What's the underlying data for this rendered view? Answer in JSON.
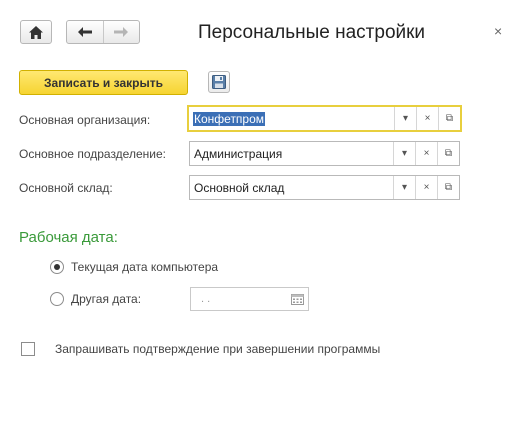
{
  "window": {
    "title": "Персональные настройки",
    "close_glyph": "×"
  },
  "nav": {
    "home_icon": "home-icon",
    "back_icon": "arrow-left-icon",
    "forward_icon": "arrow-right-icon"
  },
  "toolbar": {
    "save_close_label": "Записать и закрыть",
    "save_icon": "floppy-disk-icon"
  },
  "fields": [
    {
      "label": "Основная организация:",
      "value": "Конфетпром",
      "selected": true
    },
    {
      "label": "Основное подразделение:",
      "value": "Администрация",
      "selected": false
    },
    {
      "label": "Основной склад:",
      "value": "Основной склад",
      "selected": false
    }
  ],
  "field_buttons": {
    "dropdown": "▾",
    "clear": "×",
    "open": "⧉"
  },
  "work_date": {
    "section_title": "Рабочая дата:",
    "option_current": "Текущая дата компьютера",
    "option_other": "Другая дата:",
    "selected_option": "current",
    "date_placeholder": " .  . "
  },
  "confirm_exit": {
    "label": "Запрашивать подтверждение при завершении программы",
    "checked": false
  },
  "colors": {
    "accent_button": "#f6d431",
    "section_green": "#3a9a3a",
    "selection_blue": "#3b6fb6",
    "focus_border": "#e8cf3d"
  }
}
